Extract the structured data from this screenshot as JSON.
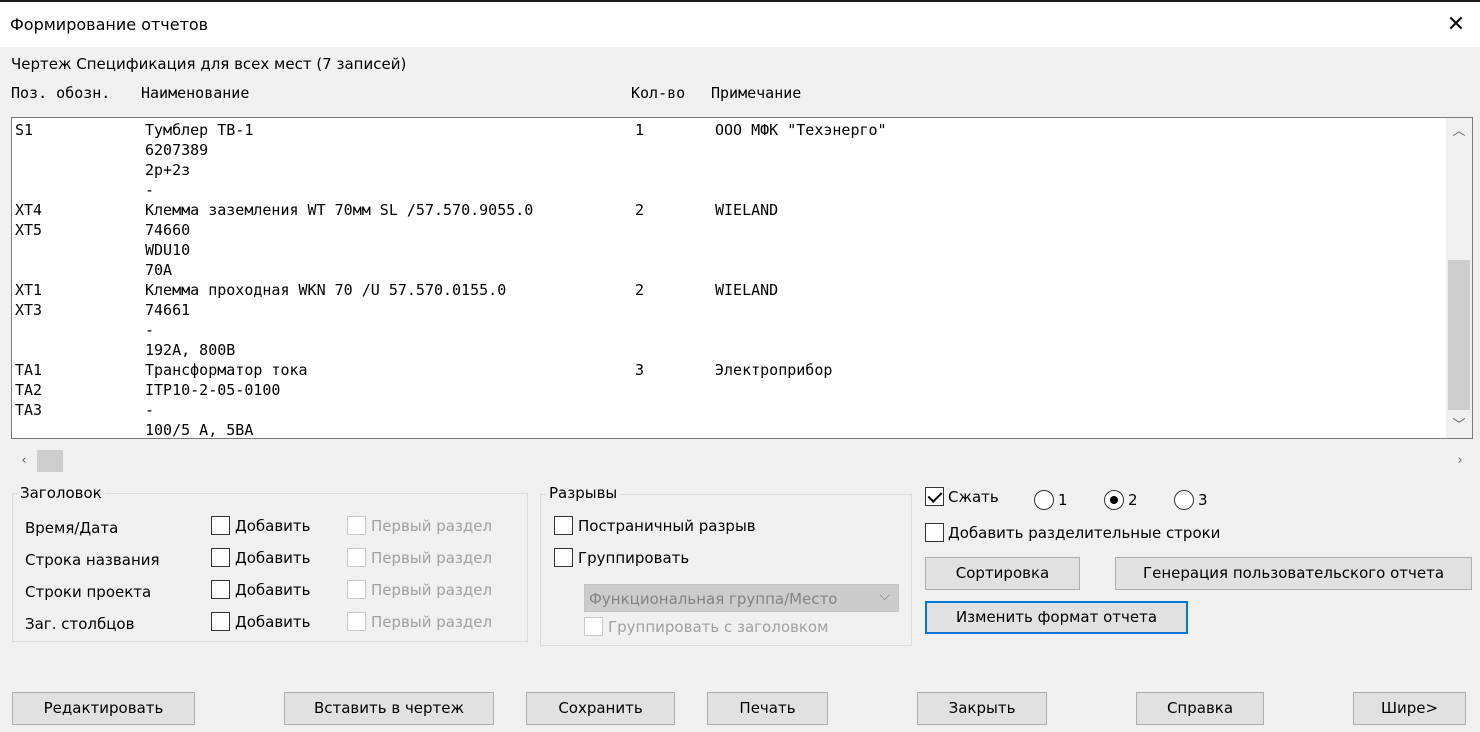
{
  "window": {
    "title": "Формирование отчетов",
    "close_glyph": "✕"
  },
  "report_info": "Чертеж Спецификация для всех мест (7 записей)",
  "columns": {
    "pos": "Поз. обозн.",
    "name": "Наименование",
    "qty": "Кол-во",
    "note": "Примечание"
  },
  "rows": [
    {
      "pos": [
        "S1"
      ],
      "name": [
        "Тумблер ТВ-1",
        "6207389",
        "2р+2з",
        "-"
      ],
      "qty": "1",
      "note": "ООО МФК \"Техэнерго\""
    },
    {
      "pos": [
        "XT4",
        "XT5"
      ],
      "name": [
        "Клемма заземления WT 70мм SL /57.570.9055.0",
        "74660",
        "WDU10",
        "70A"
      ],
      "qty": "2",
      "note": "WIELAND"
    },
    {
      "pos": [
        "XT1",
        "XT3"
      ],
      "name": [
        "Клемма проходная WKN 70 /U 57.570.0155.0",
        "74661",
        "-",
        "192А, 800В"
      ],
      "qty": "2",
      "note": "WIELAND"
    },
    {
      "pos": [
        "TA1",
        "TA2",
        "TA3"
      ],
      "name": [
        "Трансформатор тока",
        "ITP10-2-05-0100",
        "-",
        "100/5 А, 5ВА"
      ],
      "qty": "3",
      "note": "Электроприбор"
    }
  ],
  "scroll_icons": {
    "up": "chevron-up-icon",
    "down": "chevron-down-icon",
    "left": "chevron-left-icon",
    "right": "chevron-right-icon"
  },
  "header_group": {
    "title": "Заголовок",
    "items": [
      {
        "label": "Время/Дата",
        "add": "Добавить",
        "first": "Первый раздел"
      },
      {
        "label": "Строка названия",
        "add": "Добавить",
        "first": "Первый раздел"
      },
      {
        "label": "Строки проекта",
        "add": "Добавить",
        "first": "Первый раздел"
      },
      {
        "label": "Заг. столбцов",
        "add": "Добавить",
        "first": "Первый раздел"
      }
    ]
  },
  "breaks_group": {
    "title": "Разрывы",
    "page_break": "Постраничный разрыв",
    "group": "Группировать",
    "group_by_value": "Функциональная группа/Место",
    "group_with_header": "Группировать с заголовком"
  },
  "compress": {
    "label": "Сжать",
    "checked": true,
    "options": [
      "1",
      "2",
      "3"
    ],
    "selected": "2"
  },
  "separator_rows": "Добавить разделительные строки",
  "buttons": {
    "sort": "Сортировка",
    "custom_report": "Генерация пользовательского отчета",
    "change_format": "Изменить формат отчета",
    "edit": "Редактировать",
    "insert": "Вставить в чертеж",
    "save": "Сохранить",
    "print": "Печать",
    "close": "Закрыть",
    "help": "Справка",
    "wider": "Шире>"
  }
}
